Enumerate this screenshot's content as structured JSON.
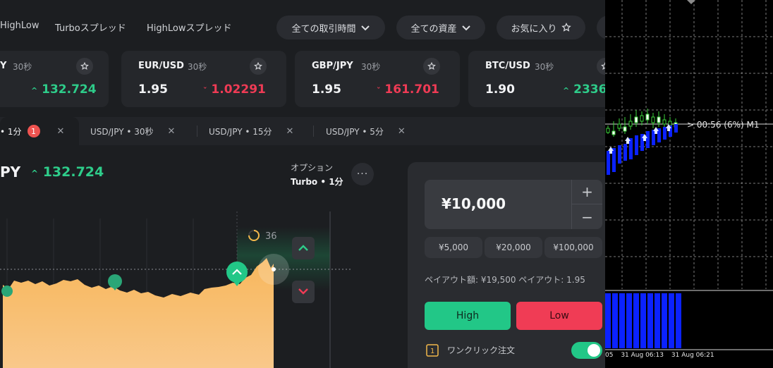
{
  "nav": {
    "links": [
      "HighLow",
      "Turboスプレッド",
      "HighLowスプレッド"
    ],
    "filters": [
      "全ての取引時間",
      "全ての資産",
      "お気に入り"
    ]
  },
  "cards": [
    {
      "symbol": "Y",
      "duration": "30秒",
      "payout": "",
      "price": "132.724",
      "direction": "up"
    },
    {
      "symbol": "EUR/USD",
      "duration": "30秒",
      "payout": "1.95",
      "price": "1.02291",
      "direction": "down"
    },
    {
      "symbol": "GBP/JPY",
      "duration": "30秒",
      "payout": "1.95",
      "price": "161.701",
      "direction": "down"
    },
    {
      "symbol": "BTC/USD",
      "duration": "30秒",
      "payout": "1.90",
      "price": "2336",
      "direction": "up"
    }
  ],
  "tabs": [
    {
      "label": "• 1分",
      "badge": "1",
      "active": true
    },
    {
      "label": "USD/JPY • 30秒"
    },
    {
      "label": "USD/JPY • 15分"
    },
    {
      "label": "USD/JPY • 5分"
    }
  ],
  "chart_header": {
    "symbol": "PY",
    "price": "132.724",
    "option_label": "オプション",
    "option_value": "Turbo • 1分",
    "countdown": "36"
  },
  "trade": {
    "amount": "¥10,000",
    "presets": [
      "¥5,000",
      "¥20,000",
      "¥100,000"
    ],
    "payout_info": "ペイアウト額: ¥19,500 ペイアウト: 1.95",
    "high_label": "High",
    "low_label": "Low",
    "one_click_label": "ワンクリック注文",
    "one_click_on": true
  },
  "mt4": {
    "timer_label": "> 00:56 (6%) M1",
    "time_labels": [
      "05",
      "31 Aug 06:13",
      "31 Aug 06:21"
    ]
  },
  "colors": {
    "up": "#2ecc8a",
    "down": "#ef3b55",
    "high_button": "#22c787",
    "low_button": "#f03c55",
    "area": "#f6b35a",
    "mt4_bars": "#0b22ff"
  },
  "icons": {
    "star": "star-icon",
    "chevron": "chevron-down-icon",
    "close": "close-icon",
    "more": "more-icon"
  }
}
